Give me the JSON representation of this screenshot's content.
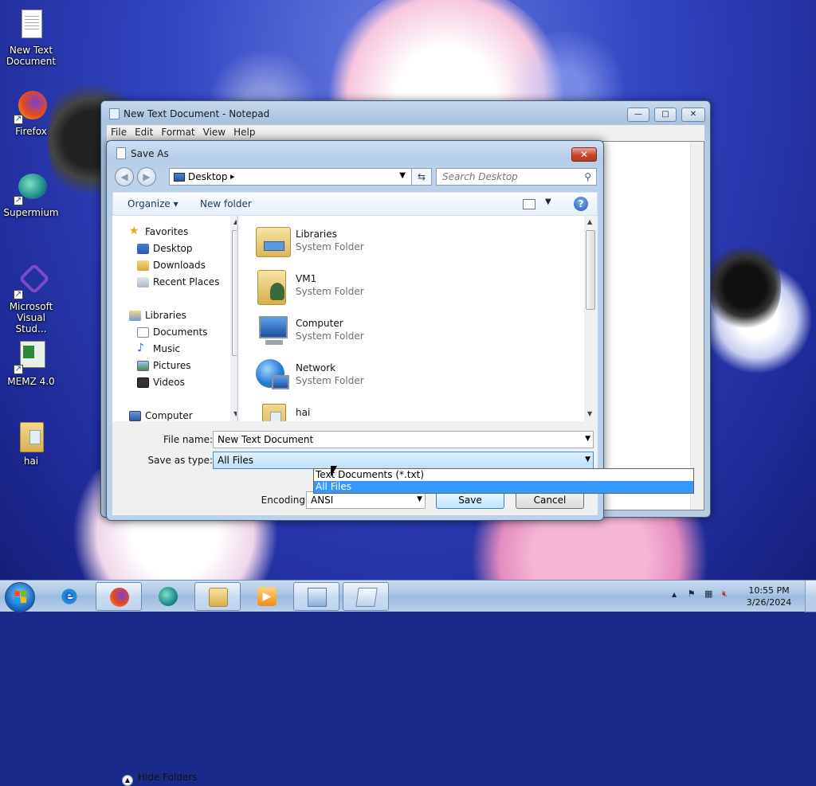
{
  "desktop": {
    "icons": [
      {
        "label": "New Text\nDocument",
        "icon": "text-document-icon"
      },
      {
        "label": "Firefox",
        "icon": "firefox-icon"
      },
      {
        "label": "Supermium",
        "icon": "supermium-icon"
      },
      {
        "label": "Microsoft\nVisual Stud...",
        "icon": "visual-studio-icon"
      },
      {
        "label": "MEMZ 4.0",
        "icon": "memz-icon"
      },
      {
        "label": "hai",
        "icon": "folder-icon"
      }
    ]
  },
  "notepad": {
    "title": "New Text Document - Notepad",
    "menu": [
      "File",
      "Edit",
      "Format",
      "View",
      "Help"
    ],
    "minimize": "—",
    "maximize": "□",
    "close": "✕"
  },
  "save_as": {
    "title": "Save As",
    "close": "✕",
    "address": {
      "location": "Desktop",
      "separator": "▸",
      "dropdown": "▼"
    },
    "refresh": "⇆",
    "search_placeholder": "Search Desktop",
    "toolbar": {
      "organize": "Organize ▾",
      "new_folder": "New folder",
      "view_dd": "▼",
      "help": "?"
    },
    "nav": {
      "favorites": "Favorites",
      "favorites_items": [
        "Desktop",
        "Downloads",
        "Recent Places"
      ],
      "libraries": "Libraries",
      "libraries_items": [
        "Documents",
        "Music",
        "Pictures",
        "Videos"
      ],
      "computer": "Computer"
    },
    "files": [
      {
        "name": "Libraries",
        "type": "System Folder"
      },
      {
        "name": "VM1",
        "type": "System Folder"
      },
      {
        "name": "Computer",
        "type": "System Folder"
      },
      {
        "name": "Network",
        "type": "System Folder"
      },
      {
        "name": "hai",
        "type": ""
      }
    ],
    "file_name_label": "File name:",
    "file_name_value": "New Text Document",
    "save_type_label": "Save as type:",
    "save_type_value": "All Files",
    "save_type_options": [
      "Text Documents (*.txt)",
      "All Files"
    ],
    "save_type_selected": 1,
    "encoding_label": "Encoding:",
    "encoding_value": "ANSI",
    "save_button": "Save",
    "cancel_button": "Cancel",
    "hide_folders": "Hide Folders"
  },
  "taskbar": {
    "pinned": [
      "internet-explorer-icon",
      "firefox-icon",
      "supermium-icon",
      "explorer-icon",
      "media-player-icon",
      "control-panel-icon",
      "notepad-icon"
    ],
    "tray_arrow": "▲",
    "time": "10:55 PM",
    "date": "3/26/2024"
  },
  "colors": {
    "accent": "#3399ff",
    "taskbar": "#a8c4e4",
    "wallpaper": "#2a3db5"
  }
}
